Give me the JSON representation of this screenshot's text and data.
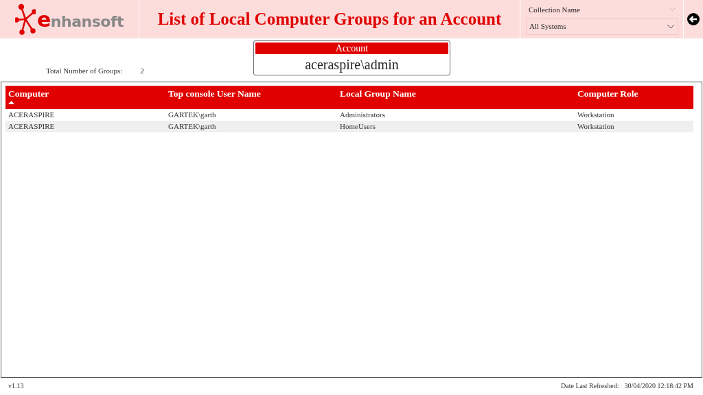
{
  "header": {
    "logo_text": "enhansoft",
    "title": "List of Local Computer Groups for an Account"
  },
  "slicer": {
    "label": "Collection Name",
    "value": "All Systems"
  },
  "summary": {
    "label": "Total Number of Groups:",
    "value": "2"
  },
  "account_card": {
    "title": "Account",
    "value": "aceraspire\\admin"
  },
  "table": {
    "columns": [
      {
        "label": "Computer",
        "sorted": true
      },
      {
        "label": "Top console User Name",
        "sorted": false
      },
      {
        "label": "Local Group Name",
        "sorted": false
      },
      {
        "label": "Computer Role",
        "sorted": false
      }
    ],
    "rows": [
      [
        "ACERASPIRE",
        "GARTEK\\garth",
        "Administrators",
        "Workstation"
      ],
      [
        "ACERASPIRE",
        "GARTEK\\garth",
        "HomeUsers",
        "Workstation"
      ]
    ]
  },
  "footer": {
    "version": "v1.13",
    "refreshed_label": "Date Last Refreshed:",
    "refreshed_value": "30/04/2020 12:18:42 PM"
  }
}
